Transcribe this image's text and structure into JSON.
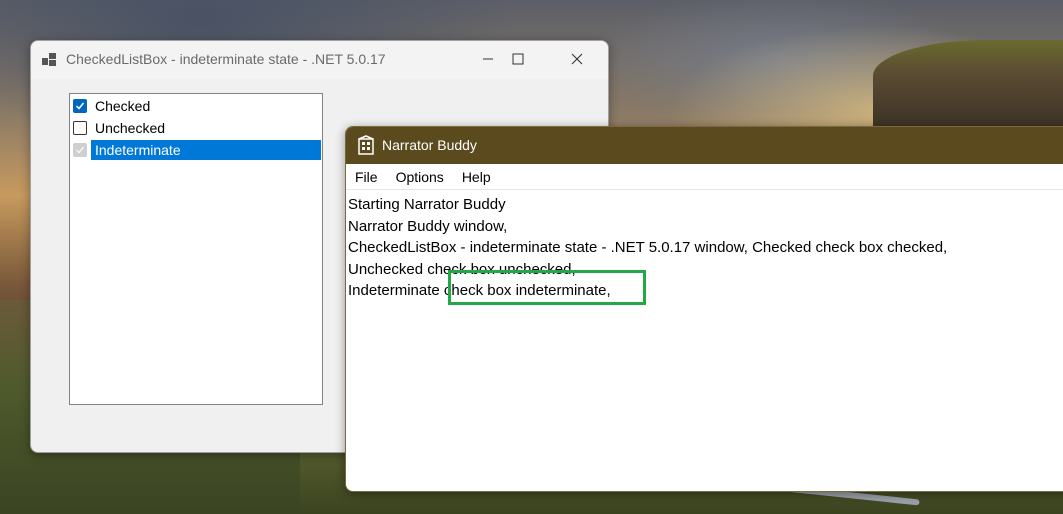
{
  "window1": {
    "title": "CheckedListBox - indeterminate state - .NET 5.0.17",
    "items": [
      {
        "label": "Checked",
        "state": "checked",
        "selected": false
      },
      {
        "label": "Unchecked",
        "state": "unchecked",
        "selected": false
      },
      {
        "label": "Indeterminate",
        "state": "indeterminate",
        "selected": true
      }
    ]
  },
  "window2": {
    "title": "Narrator Buddy",
    "menu": [
      "File",
      "Options",
      "Help"
    ],
    "lines": [
      "Starting Narrator Buddy",
      "Narrator Buddy window,",
      "CheckedListBox - indeterminate state - .NET 5.0.17 window, Checked check box checked,",
      "Unchecked check box unchecked,",
      "Indeterminate check box indeterminate,"
    ]
  },
  "colors": {
    "narrator_titlebar": "#5b4a1e",
    "selection": "#0078d7",
    "checkbox_checked": "#0067c0",
    "highlight_box": "#22a845"
  }
}
